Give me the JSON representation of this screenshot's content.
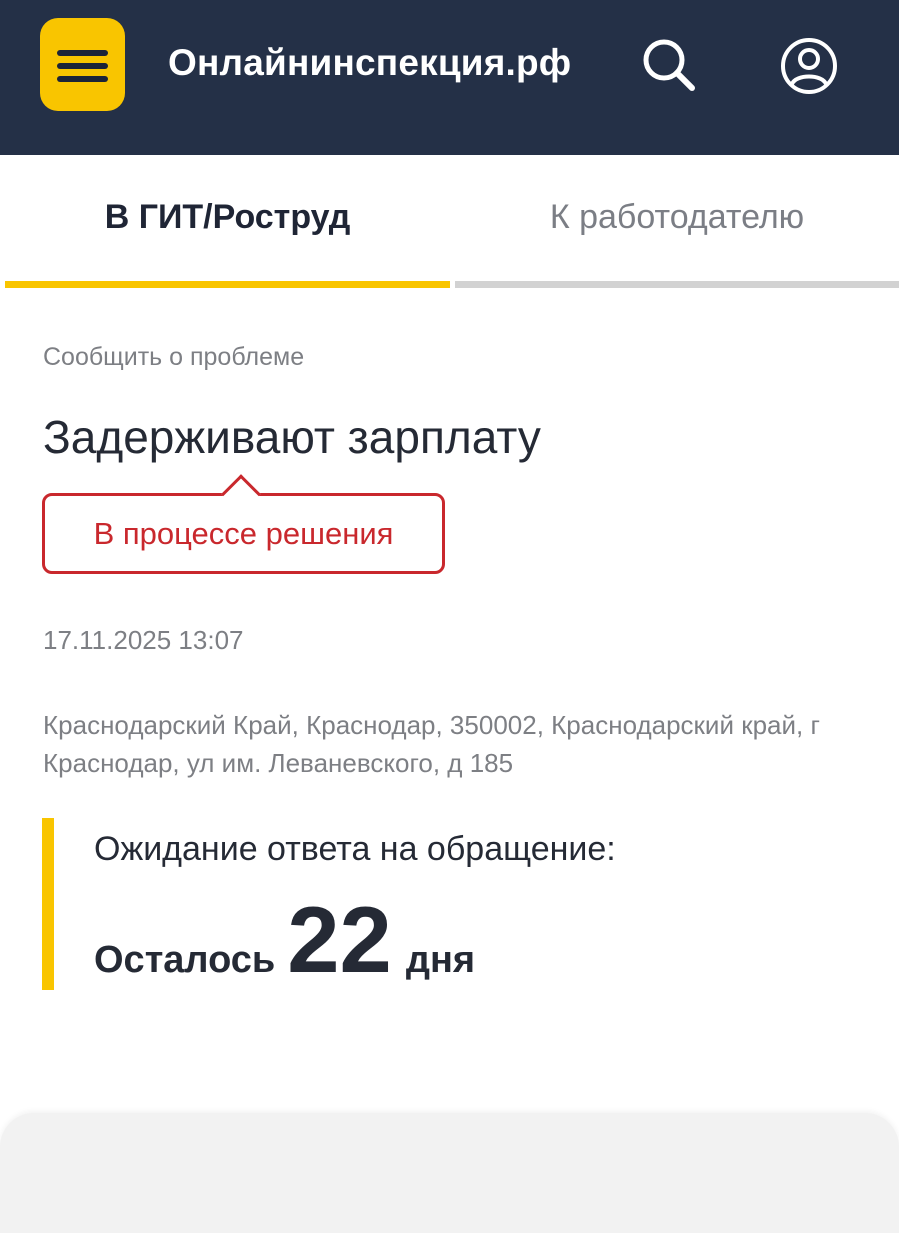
{
  "header": {
    "menu_icon": "hamburger-icon",
    "brand": "Онлайнинспекция.рф",
    "search_icon": "search-icon",
    "profile_icon": "user-circle-icon",
    "colors": {
      "background": "#243047",
      "accent": "#f9c500"
    }
  },
  "tabs": [
    {
      "label": "В ГИТ/Роструд",
      "active": true
    },
    {
      "label": "К работодателю",
      "active": false
    }
  ],
  "report": {
    "category": "Сообщить о проблеме",
    "title": "Задерживают зарплату",
    "status": "В процессе решения",
    "status_color": "#c9282d",
    "datetime": "17.11.2025 13:07",
    "address": "Краснодарский Край, Краснодар, 350002, Краснодарский край, г Краснодар, ул им. Леваневского, д 185"
  },
  "wait": {
    "label": "Ожидание ответа на обращение:",
    "remaining_prefix": "Осталось",
    "remaining_number": "22",
    "remaining_unit": "дня"
  }
}
